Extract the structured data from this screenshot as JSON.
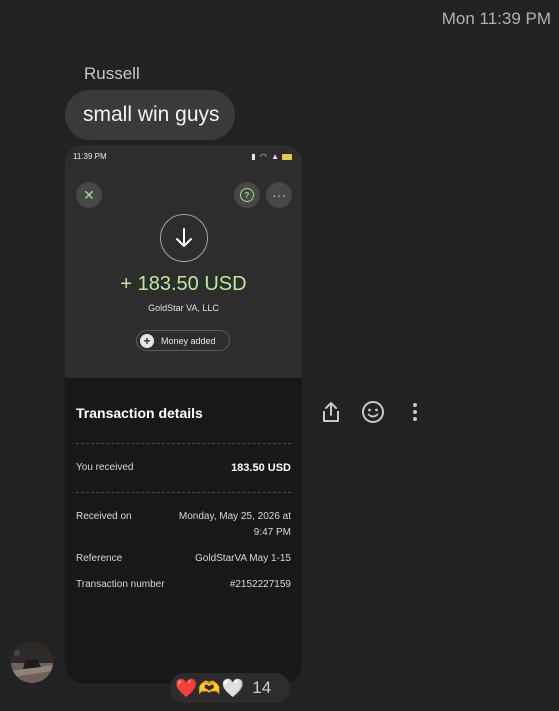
{
  "header": {
    "timestamp": "Mon 11:39 PM"
  },
  "message": {
    "sender": "Russell",
    "text": "small win guys"
  },
  "screenshot": {
    "status_time": "11:39 PM",
    "amount": "+ 183.50 USD",
    "merchant": "GoldStar VA, LLC",
    "chip_label": "Money added",
    "section_title": "Transaction details",
    "rows": [
      {
        "label": "You received",
        "value": "183.50 USD"
      },
      {
        "label": "Received on",
        "value_line1": "Monday, May 25, 2026 at",
        "value_line2": "9:47 PM"
      },
      {
        "label": "Reference",
        "value": "GoldStarVA May 1-15"
      },
      {
        "label": "Transaction number",
        "value": "#2152227159"
      }
    ],
    "accent_color": "#bfe7a2"
  },
  "actions": [
    {
      "name": "share-icon"
    },
    {
      "name": "emoji-icon"
    },
    {
      "name": "more-options-icon"
    }
  ],
  "reactions": {
    "emojis": [
      "❤️",
      "🫶",
      "🤍"
    ],
    "count": "14"
  }
}
